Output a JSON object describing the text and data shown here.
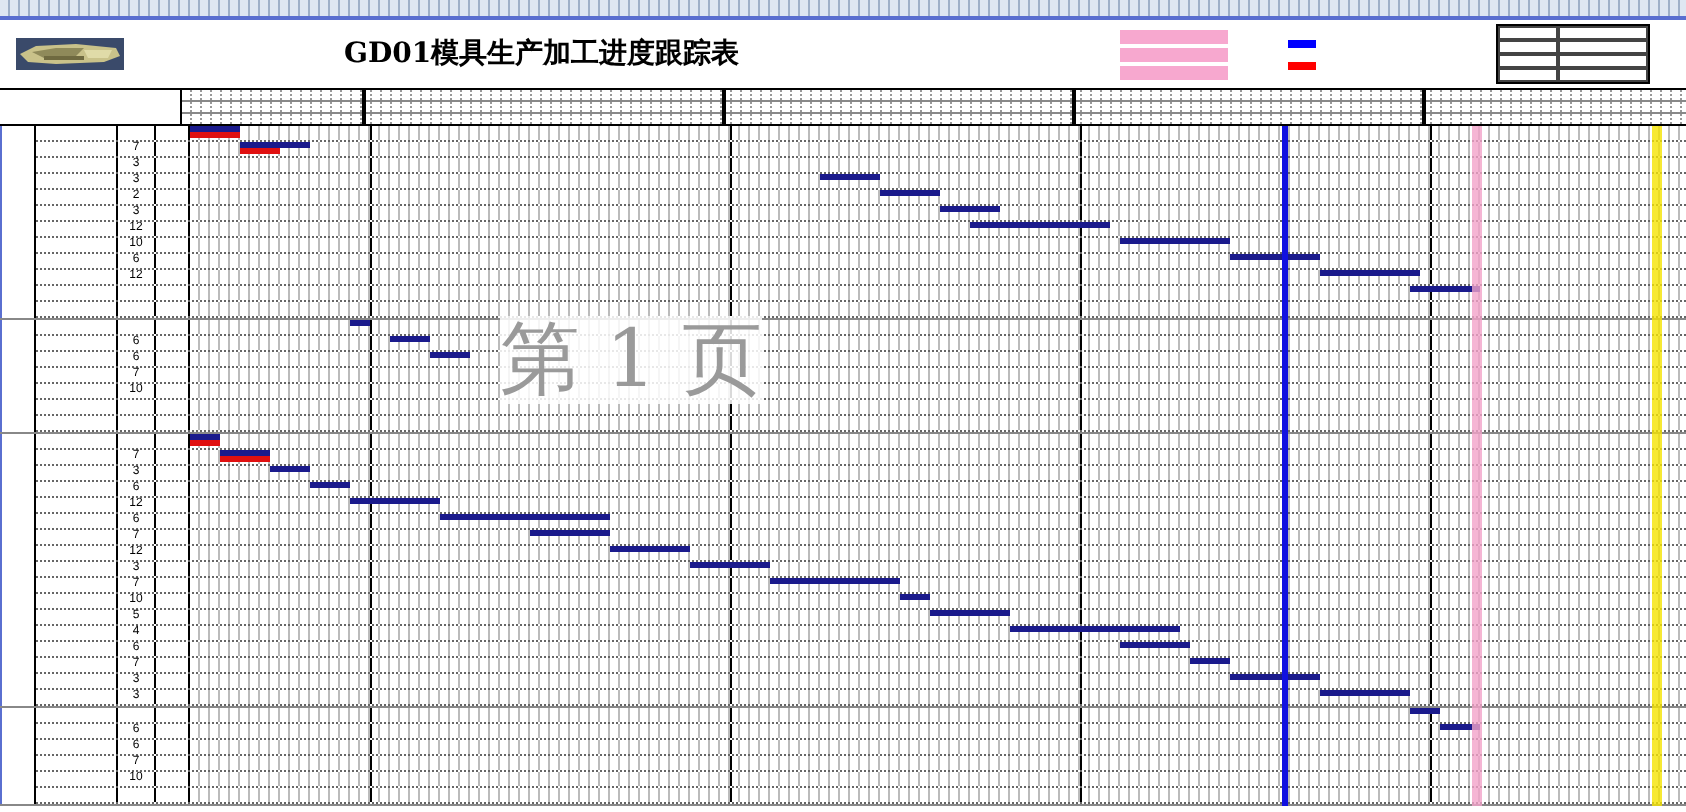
{
  "title": "GD01模具生产加工进度跟踪表",
  "page_label": "第 1 页",
  "groups": [
    {
      "rows": [
        {
          "duration": ""
        },
        {
          "duration": "7"
        },
        {
          "duration": "3"
        },
        {
          "duration": "3"
        },
        {
          "duration": "2"
        },
        {
          "duration": "3"
        },
        {
          "duration": "12"
        },
        {
          "duration": "10"
        },
        {
          "duration": "6"
        },
        {
          "duration": "12"
        },
        {
          "duration": ""
        },
        {
          "duration": ""
        }
      ]
    },
    {
      "rows": [
        {
          "duration": ""
        },
        {
          "duration": "6"
        },
        {
          "duration": "6"
        },
        {
          "duration": "7"
        },
        {
          "duration": "10"
        },
        {
          "duration": ""
        },
        {
          "duration": ""
        }
      ]
    },
    {
      "rows": [
        {
          "duration": ""
        },
        {
          "duration": "7"
        },
        {
          "duration": "3"
        },
        {
          "duration": "6"
        },
        {
          "duration": "12"
        },
        {
          "duration": "6"
        },
        {
          "duration": "7"
        },
        {
          "duration": "12"
        },
        {
          "duration": "3"
        },
        {
          "duration": "7"
        },
        {
          "duration": "10"
        },
        {
          "duration": "5"
        },
        {
          "duration": "4"
        },
        {
          "duration": "6"
        },
        {
          "duration": "7"
        },
        {
          "duration": "3"
        },
        {
          "duration": "3"
        }
      ]
    },
    {
      "rows": [
        {
          "duration": ""
        },
        {
          "duration": "6"
        },
        {
          "duration": "6"
        },
        {
          "duration": "7"
        },
        {
          "duration": "10"
        },
        {
          "duration": ""
        }
      ]
    }
  ]
}
